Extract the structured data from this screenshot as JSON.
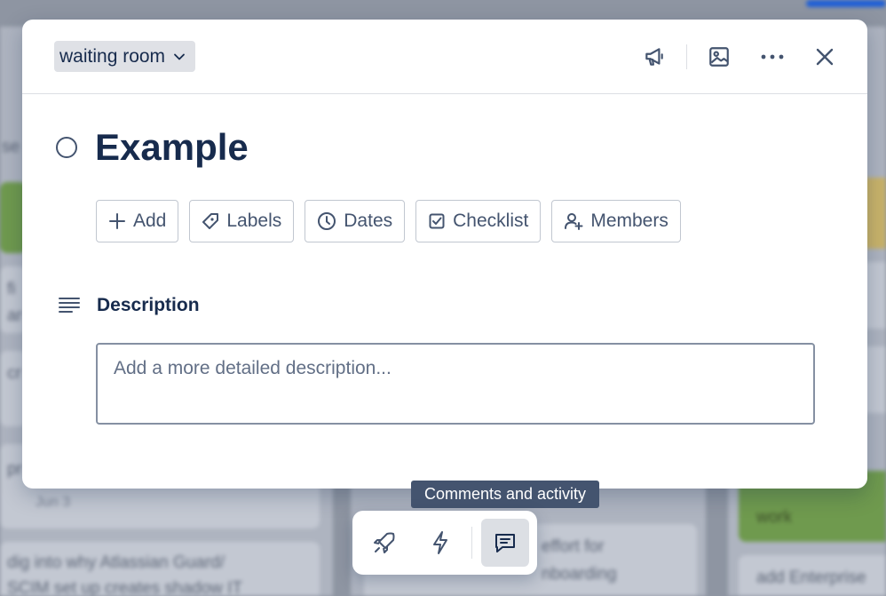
{
  "background": {
    "cards": [
      {
        "text": "se"
      },
      {
        "text": "fi"
      },
      {
        "text": "ar"
      },
      {
        "text": "cr"
      },
      {
        "text": "pr"
      },
      {
        "text": "Jun 3"
      },
      {
        "text": "dig into why Atlassian Guard/"
      },
      {
        "text": "SCIM set up creates shadow IT"
      },
      {
        "text": "effort for"
      },
      {
        "text": "nboarding"
      },
      {
        "text": "work"
      },
      {
        "text": "add Enterprise"
      }
    ]
  },
  "modal": {
    "list_selector": {
      "label": "waiting room",
      "icon": "chevron-down-icon"
    },
    "header_icons": [
      "megaphone-icon",
      "image-icon",
      "more-icon",
      "close-icon"
    ],
    "card_title": "Example",
    "actions": [
      {
        "label": "Add",
        "icon": "plus-icon"
      },
      {
        "label": "Labels",
        "icon": "tag-icon"
      },
      {
        "label": "Dates",
        "icon": "clock-icon"
      },
      {
        "label": "Checklist",
        "icon": "checklist-icon"
      },
      {
        "label": "Members",
        "icon": "add-member-icon"
      }
    ],
    "description": {
      "heading": "Description",
      "placeholder": "Add a more detailed description..."
    }
  },
  "tooltip": {
    "text": "Comments and activity"
  },
  "toolbar": {
    "buttons": [
      {
        "icon": "rocket-icon",
        "active": false
      },
      {
        "icon": "lightning-icon",
        "active": false
      },
      {
        "icon": "comment-icon",
        "active": true
      }
    ]
  },
  "colors": {
    "text_primary": "#172b4d",
    "text_secondary": "#44546f",
    "tooltip_bg": "#44546f",
    "active_button_bg": "#dcdfe4"
  }
}
